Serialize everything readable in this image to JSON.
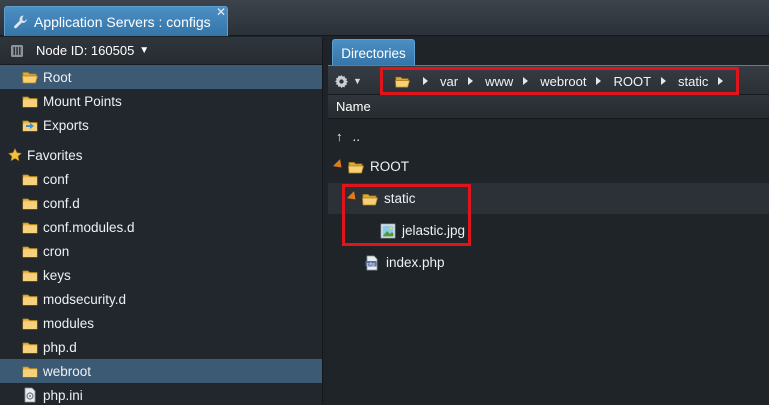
{
  "window": {
    "title": "Application Servers : configs",
    "close_label": "✕"
  },
  "node": {
    "label": "Node ID: 160505"
  },
  "tree": {
    "items": [
      {
        "label": "Root",
        "icon": "folder-open-icon",
        "selected": true
      },
      {
        "label": "Mount Points",
        "icon": "folder-icon"
      },
      {
        "label": "Exports",
        "icon": "exports-icon"
      }
    ],
    "favorites_label": "Favorites",
    "favorites": [
      {
        "label": "conf"
      },
      {
        "label": "conf.d"
      },
      {
        "label": "conf.modules.d"
      },
      {
        "label": "cron"
      },
      {
        "label": "keys"
      },
      {
        "label": "modsecurity.d"
      },
      {
        "label": "modules"
      },
      {
        "label": "php.d"
      },
      {
        "label": "webroot",
        "selected": true
      },
      {
        "label": "php.ini",
        "file": true
      }
    ]
  },
  "directories_tab": {
    "label": "Directories"
  },
  "breadcrumb": [
    "var",
    "www",
    "webroot",
    "ROOT",
    "static"
  ],
  "column": {
    "name": "Name"
  },
  "files": {
    "up": "..",
    "root_label": "ROOT",
    "static_label": "static",
    "image_label": "jelastic.jpg",
    "php_label": "index.php"
  },
  "colors": {
    "accent": "#3d5a75",
    "highlight": "#e0141b",
    "folder": "#e8b84a"
  }
}
